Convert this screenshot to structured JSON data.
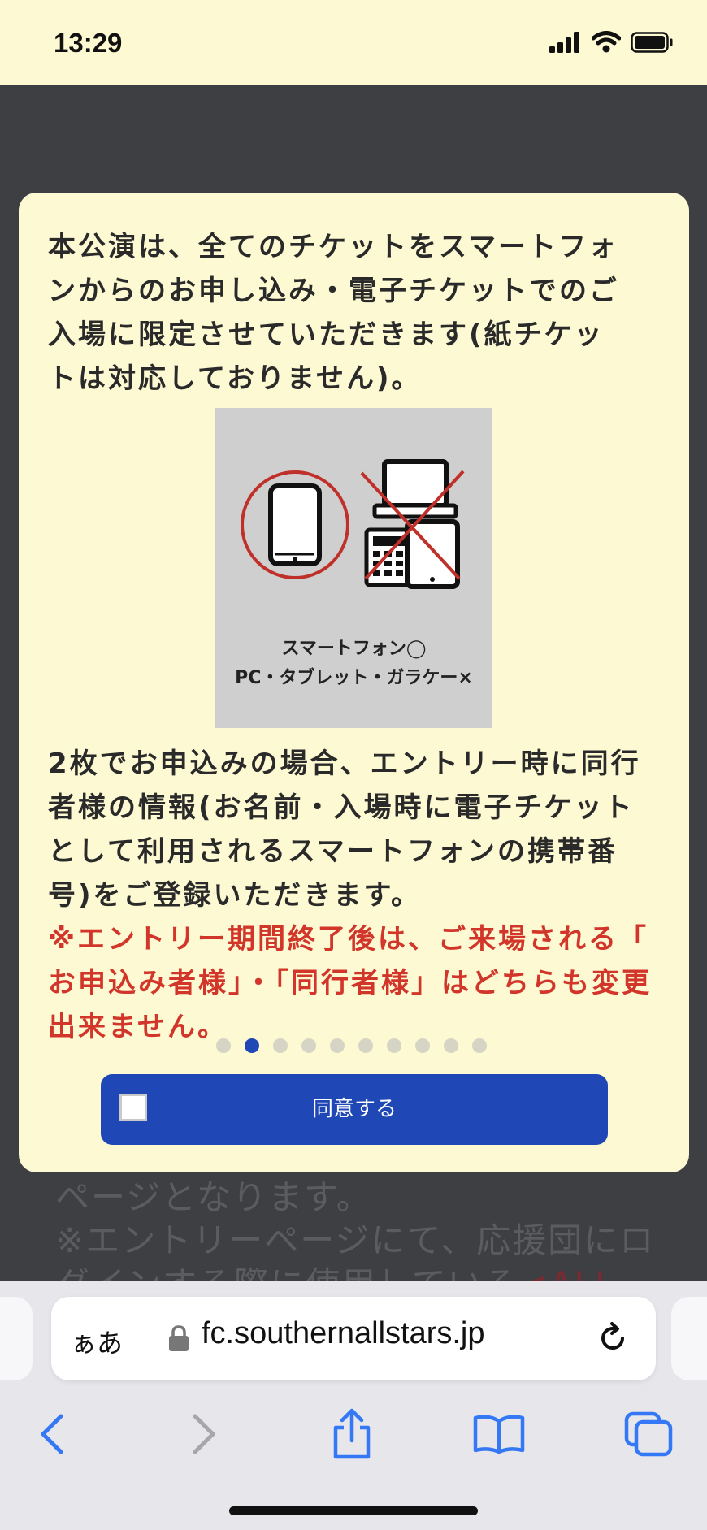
{
  "status": {
    "time": "13:29"
  },
  "background": {
    "line1": "ページとなります。",
    "line2": "※エントリーページにて、応援団にロ",
    "line3_start": "グインする際に使用している",
    "line3_accent": "<ALL"
  },
  "modal": {
    "intro_lines": [
      "本公演は、全てのチケットをスマートフォ",
      "ンからのお申し込み・電子チケットでのご",
      "入場に限定させていただきます(紙チケッ",
      "トは対応しておりません)。"
    ],
    "illustration": {
      "label_line1": "スマートフォン◯",
      "label_line2": "PC・タブレット・ガラケー×"
    },
    "companion_lines": [
      "2枚でお申込みの場合、エントリー時に同行",
      "者様の情報(お名前・入場時に電子チケット",
      "として利用されるスマートフォンの携帯番",
      "号)をご登録いただきます。"
    ],
    "warning_lines": [
      "※エントリー期間終了後は、ご来場される「",
      "お申込み者様」・「同行者様」はどちらも変更",
      "出来ません。"
    ],
    "pagination": {
      "total": 10,
      "current": 2
    },
    "agree_label": "同意する",
    "agree_checked": false
  },
  "browser": {
    "text_size_label": "ぁあ",
    "url": "fc.southernallstars.jp"
  },
  "colors": {
    "modal_bg": "#fdf9d2",
    "accent_blue": "#1f47b5",
    "warning_red": "#d2362b",
    "ios_blue": "#3478f6"
  },
  "icons": [
    "signal-icon",
    "wifi-icon",
    "battery-icon",
    "smartphone-icon",
    "laptop-icon",
    "tablet-icon",
    "feature-phone-icon",
    "lock-icon",
    "reload-icon",
    "back-icon",
    "forward-icon",
    "share-icon",
    "bookmarks-icon",
    "tabs-icon"
  ]
}
